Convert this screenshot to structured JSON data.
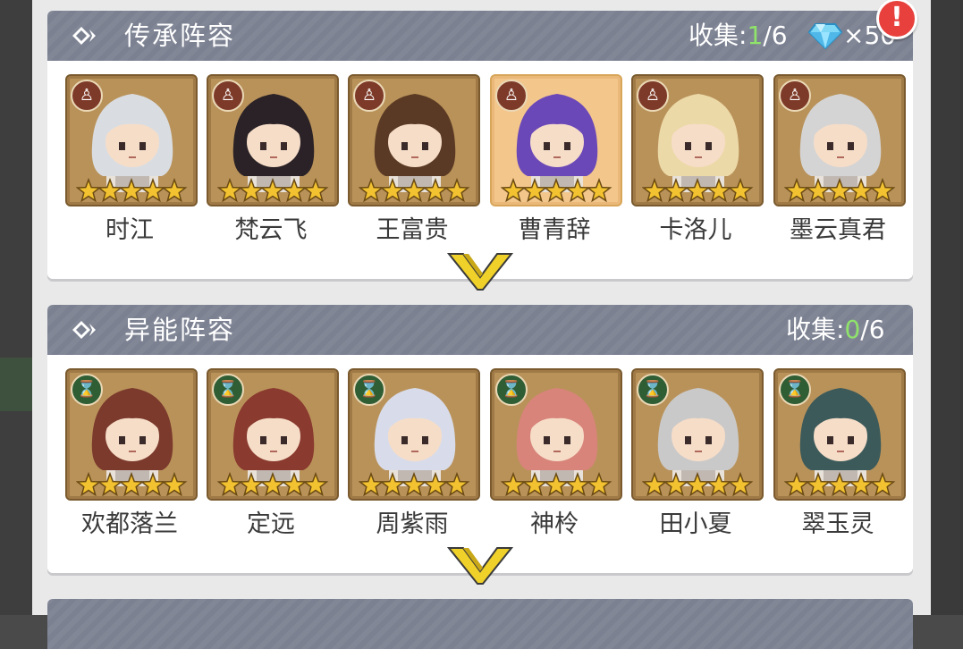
{
  "sections": [
    {
      "title": "传承阵容",
      "collect_label": "收集:",
      "collected": "1",
      "total": "/6",
      "reward": "×50",
      "badge": "!",
      "faction_icon": "meditation-icon",
      "characters": [
        {
          "name": "时江",
          "stars": 5,
          "hair": "#d9dde2"
        },
        {
          "name": "梵云飞",
          "stars": 5,
          "hair": "#2a2226"
        },
        {
          "name": "王富贵",
          "stars": 5,
          "hair": "#5a3a24"
        },
        {
          "name": "曹青辞",
          "stars": 5,
          "hair": "#6a48b8",
          "selected": true
        },
        {
          "name": "卡洛儿",
          "stars": 5,
          "hair": "#ecd9a8"
        },
        {
          "name": "墨云真君",
          "stars": 5,
          "hair": "#d4d4d4"
        }
      ]
    },
    {
      "title": "异能阵容",
      "collect_label": "收集:",
      "collected": "0",
      "total": "/6",
      "faction_icon": "dna-icon",
      "characters": [
        {
          "name": "欢都落兰",
          "stars": 5,
          "hair": "#7b3a2c"
        },
        {
          "name": "定远",
          "stars": 5,
          "hair": "#8a3a2e"
        },
        {
          "name": "周紫雨",
          "stars": 5,
          "hair": "#d8dcea"
        },
        {
          "name": "神柃",
          "stars": 5,
          "hair": "#d8847a"
        },
        {
          "name": "田小夏",
          "stars": 5,
          "hair": "#c9c9c9"
        },
        {
          "name": "翠玉灵",
          "stars": 5,
          "hair": "#3c5a5a"
        }
      ]
    }
  ],
  "colors": {
    "header_bg": "#7b8191",
    "collected_count": "#8fe36a",
    "card_bg": "#b9925a",
    "card_selected_bg": "#f3c68c",
    "star": "#f2c230",
    "chevron": "#f0d12a",
    "alert": "#e8403c"
  },
  "icons": [
    "diamond-arrow-icon",
    "gem-icon",
    "alert-icon",
    "meditation-icon",
    "dna-icon",
    "star-icon",
    "chevron-down-icon"
  ]
}
